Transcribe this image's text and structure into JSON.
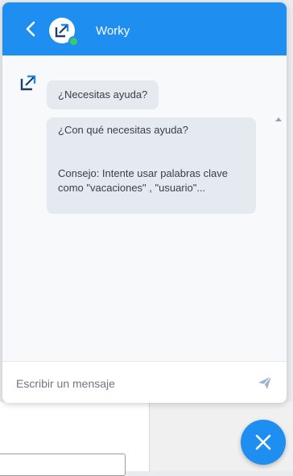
{
  "colors": {
    "accent": "#1e8ff0",
    "online": "#3ccb6b",
    "bubble": "#e4eaf0"
  },
  "header": {
    "title": "Worky",
    "back_icon": "chevron-left-icon",
    "avatar_icon": "worky-logo-icon",
    "status": "online"
  },
  "messages": [
    {
      "sender": "bot",
      "text": "¿Necesitas ayuda?"
    },
    {
      "sender": "bot",
      "lines": [
        "¿Con qué necesitas ayuda?",
        "",
        "",
        "Consejo: Intente usar palabras clave",
        "como \"vacaciones\" , \"usuario\"..."
      ]
    }
  ],
  "composer": {
    "placeholder": "Escribir un mensaje",
    "send_icon": "paper-plane-icon"
  },
  "launcher": {
    "icon": "close-icon"
  }
}
